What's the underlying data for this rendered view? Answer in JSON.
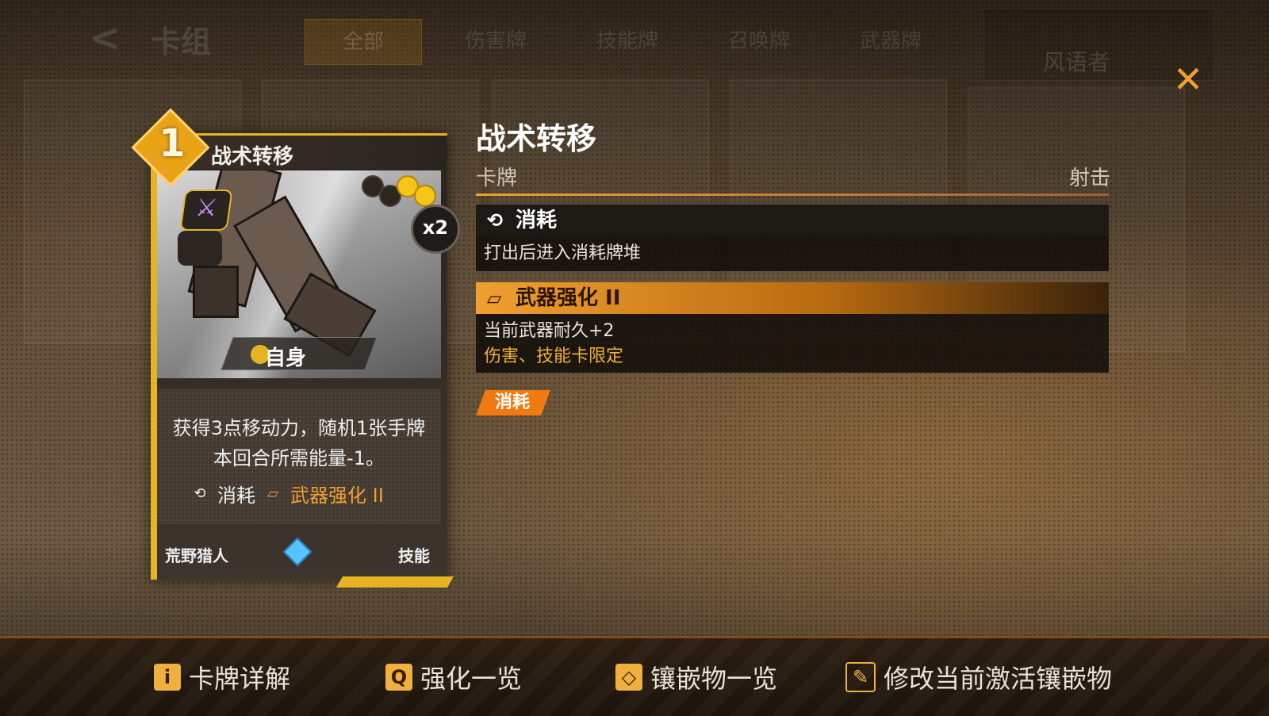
{
  "background_deck": {
    "back_icon": "back-arrow-icon",
    "title": "卡组",
    "filter_tabs": [
      "全部",
      "伤害牌",
      "技能牌",
      "召唤牌",
      "武器牌"
    ],
    "active_tab": "全部",
    "character": "风语者"
  },
  "close": {
    "icon": "close-icon",
    "glyph": "✕"
  },
  "card": {
    "cost": "1",
    "name": "战术转移",
    "copies": "x2",
    "energy_slots_filled": 2,
    "energy_slots_total": 4,
    "target": "自身",
    "description": "获得3点移动力，随机1张手牌本回合所需能量-1。",
    "keyword_consume": "消耗",
    "keyword_weapon": "武器强化 II",
    "class": "荒野猎人",
    "type": "技能",
    "type_icon": "sword-icon"
  },
  "detail": {
    "title": "战术转移",
    "category": "卡牌",
    "subtype": "射击",
    "keywords": [
      {
        "name": "消耗",
        "icon": "consume-icon",
        "lines": [
          "打出后进入消耗牌堆"
        ]
      },
      {
        "name": "武器强化 II",
        "icon": "weapon-inlay-icon",
        "lines": [
          "当前武器耐久+2",
          "伤害、技能卡限定"
        ]
      }
    ],
    "tag": "消耗"
  },
  "bottom_bar": {
    "details": {
      "label": "卡牌详解",
      "icon": "info-icon",
      "glyph": "i"
    },
    "upgrades": {
      "label": "强化一览",
      "icon": "search-icon",
      "glyph": "Q"
    },
    "inlays": {
      "label": "镶嵌物一览",
      "icon": "inlay-icon",
      "glyph": "◇"
    },
    "modify": {
      "label": "修改当前激活镶嵌物",
      "icon": "edit-icon",
      "glyph": "✎"
    }
  },
  "colors": {
    "accent": "#f0a030",
    "card_border": "#e6b422",
    "tag": "#f07a10"
  }
}
